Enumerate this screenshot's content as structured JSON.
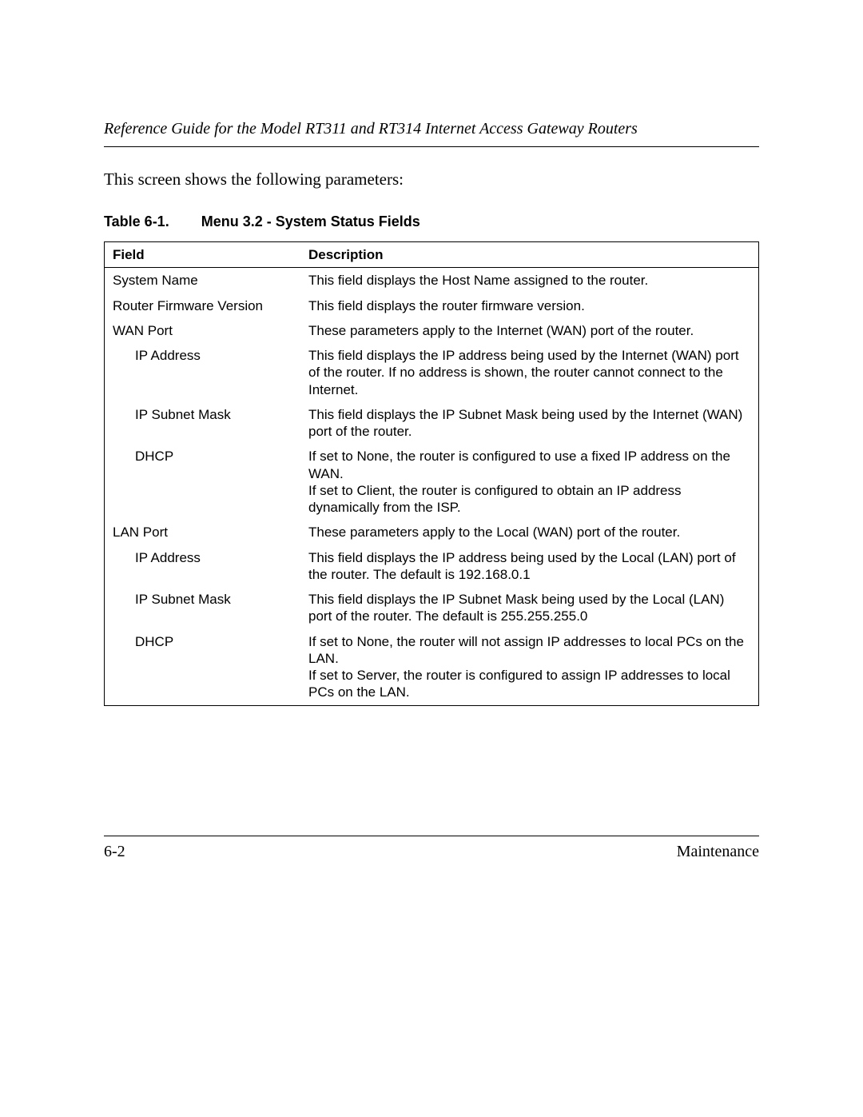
{
  "header": {
    "running_title": "Reference Guide for the Model RT311 and RT314 Internet Access Gateway Routers"
  },
  "intro_text": "This screen shows the following parameters:",
  "table_caption": {
    "label": "Table 6-1.",
    "title": "Menu 3.2 - System Status Fields"
  },
  "table": {
    "headers": {
      "field": "Field",
      "description": "Description"
    },
    "rows": [
      {
        "indent": 0,
        "field": "System Name",
        "description": "This field displays the Host Name assigned to the router."
      },
      {
        "indent": 0,
        "field": "Router Firmware Version",
        "description": "This field displays the router firmware version."
      },
      {
        "indent": 0,
        "field": "WAN Port",
        "description": "These parameters apply to the Internet (WAN) port of the router."
      },
      {
        "indent": 1,
        "field": "IP Address",
        "description": "This field displays the IP address being used by the Internet (WAN) port of the router. If no address is shown, the router cannot connect to the Internet."
      },
      {
        "indent": 1,
        "field": "IP Subnet Mask",
        "description": "This field displays the IP Subnet Mask being used by the Internet (WAN) port of the router."
      },
      {
        "indent": 1,
        "field": "DHCP",
        "description": "If set to None, the router is configured to use a fixed IP address on the WAN.\nIf set to Client, the router is configured to obtain an IP address dynamically from the ISP."
      },
      {
        "indent": 0,
        "field": "LAN Port",
        "description": "These parameters apply to the Local (WAN) port of the router."
      },
      {
        "indent": 1,
        "field": "IP Address",
        "description": "This field displays the IP address being used by the Local (LAN) port of the router. The default is 192.168.0.1"
      },
      {
        "indent": 1,
        "field": "IP Subnet Mask",
        "description": "This field displays the IP Subnet Mask being used by the Local (LAN) port of the router. The default is 255.255.255.0"
      },
      {
        "indent": 1,
        "field": "DHCP",
        "description": "If set to None, the router will not assign IP addresses to local PCs on the LAN.\nIf set to Server, the router is configured to assign IP addresses to local PCs on the LAN."
      }
    ]
  },
  "footer": {
    "page_number": "6-2",
    "section": "Maintenance"
  }
}
